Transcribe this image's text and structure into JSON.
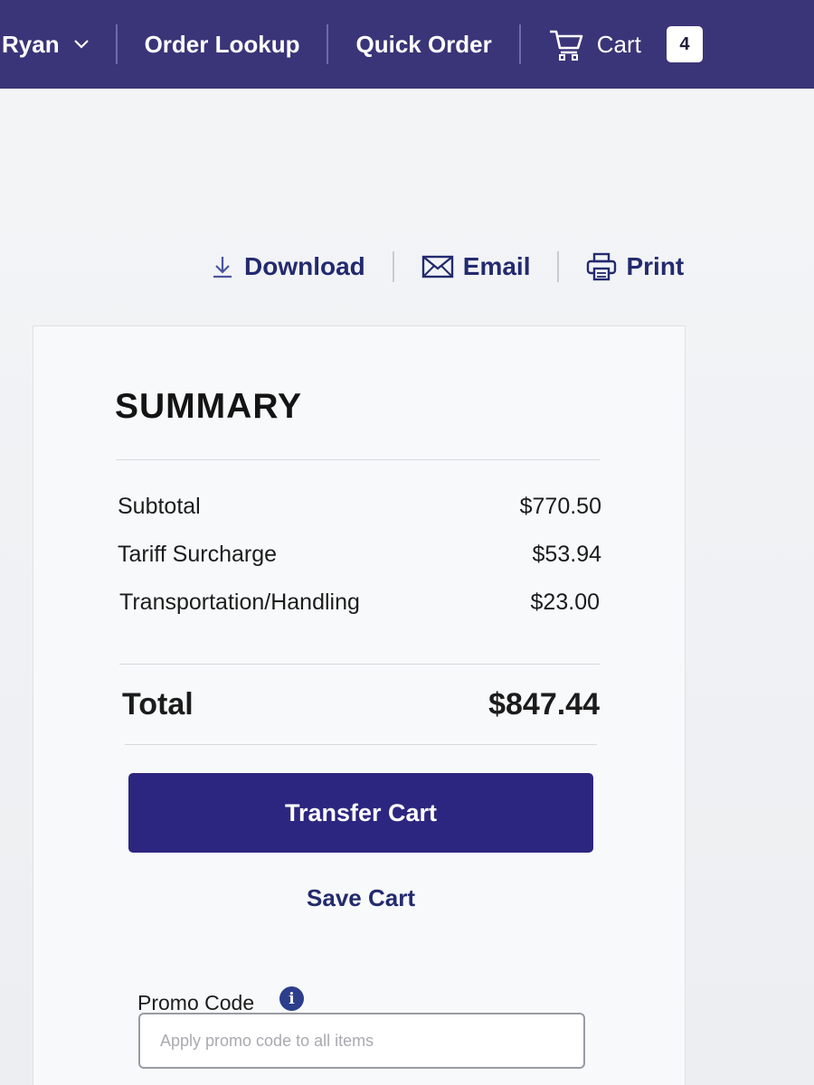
{
  "nav": {
    "user_name": "Ryan",
    "order_lookup": "Order Lookup",
    "quick_order": "Quick Order",
    "cart_label": "Cart",
    "cart_count": "4"
  },
  "actions": {
    "download": "Download",
    "email": "Email",
    "print": "Print"
  },
  "summary": {
    "title": "SUMMARY",
    "lines": [
      {
        "label": "Subtotal",
        "value": "$770.50"
      },
      {
        "label": "Tariff Surcharge",
        "value": "$53.94"
      },
      {
        "label": "Transportation/Handling",
        "value": "$23.00"
      }
    ],
    "total_label": "Total",
    "total_value": "$847.44"
  },
  "buttons": {
    "transfer_cart": "Transfer Cart",
    "save_cart": "Save Cart"
  },
  "promo": {
    "label": "Promo Code",
    "info_icon": "i",
    "placeholder": "Apply promo code to all items"
  },
  "colors": {
    "nav_bg": "#3a3578",
    "accent": "#2d2680",
    "link": "#232a6e"
  },
  "icons": {
    "user_menu": "chevron-down-icon",
    "cart": "shopping-cart-icon",
    "download": "download-icon",
    "email": "envelope-icon",
    "print": "printer-icon",
    "info": "info-icon"
  }
}
